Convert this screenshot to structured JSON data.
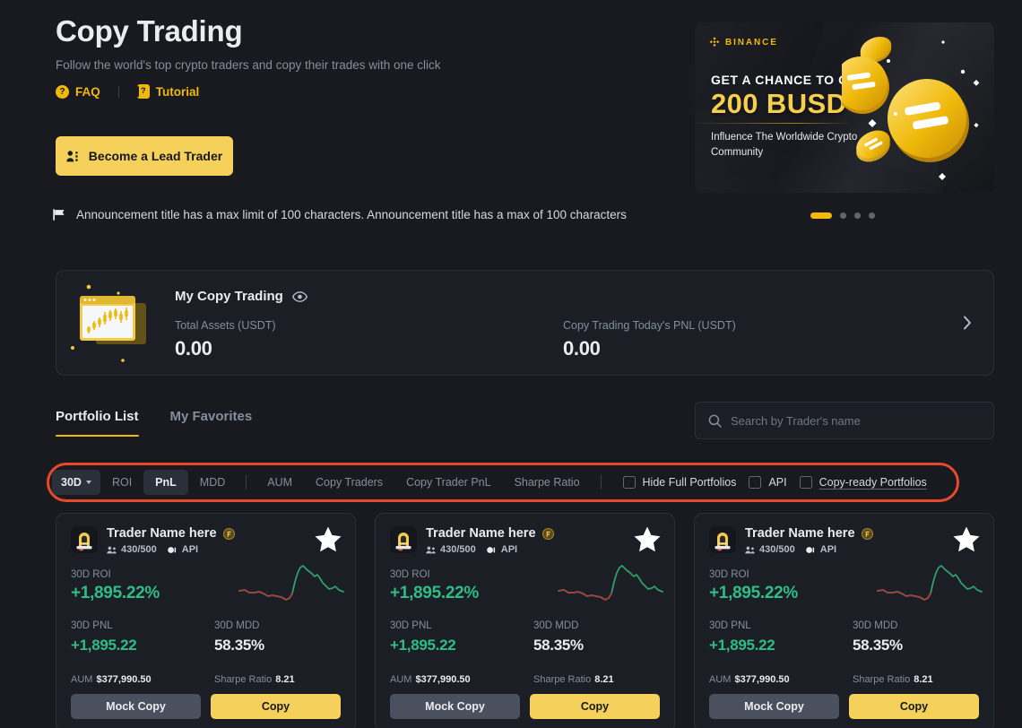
{
  "hero": {
    "title": "Copy Trading",
    "subtitle": "Follow the world's top crypto traders and copy their trades with one click",
    "faq_label": "FAQ",
    "faq_icon": "question-circle-icon",
    "tutorial_label": "Tutorial",
    "tutorial_icon": "book-question-icon",
    "lead_trader_button": "Become a Lead Trader",
    "lead_trader_icon": "people-icon"
  },
  "announcement": {
    "icon": "flag-icon",
    "text": "Announcement title has a max limit of 100 characters. Announcement title has a max of 100 characters"
  },
  "banner": {
    "brand": "BINANCE",
    "brand_icon": "binance-diamond-icon",
    "line1": "GET A CHANCE TO GET",
    "line2": "200 BUSD",
    "line3": "Influence The Worldwide Crypto Community",
    "accent_color": "#f0b90b",
    "carousel": {
      "total": 4,
      "active_index": 0
    }
  },
  "my_copy_trading": {
    "title": "My Copy Trading",
    "eye_icon": "eye-icon",
    "chevron_icon": "chevron-right-icon",
    "illustration_icon": "chart-window-icon",
    "total_assets_label": "Total Assets (USDT)",
    "total_assets_value": "0.00",
    "pnl_label": "Copy Trading  Today's PNL (USDT)",
    "pnl_value": "0.00"
  },
  "tabs": [
    {
      "label": "Portfolio List",
      "active": true
    },
    {
      "label": "My Favorites",
      "active": false
    }
  ],
  "search": {
    "icon": "search-icon",
    "placeholder": "Search by Trader's name",
    "value": ""
  },
  "filters": {
    "period": {
      "label": "30D",
      "caret_icon": "chevron-down-icon"
    },
    "metrics": [
      {
        "label": "ROI",
        "active": false
      },
      {
        "label": "PnL",
        "active": true
      },
      {
        "label": "MDD",
        "active": false
      }
    ],
    "metrics2": [
      {
        "label": "AUM",
        "active": false
      },
      {
        "label": "Copy Traders",
        "active": false
      },
      {
        "label": "Copy Trader PnL",
        "active": false
      },
      {
        "label": "Sharpe Ratio",
        "active": false
      }
    ],
    "checkboxes": [
      {
        "label": "Hide Full Portfolios",
        "checked": false,
        "underlined": false
      },
      {
        "label": "API",
        "checked": false,
        "underlined": false
      },
      {
        "label": "Copy-ready Portfolios",
        "checked": false,
        "underlined": true
      }
    ],
    "highlight_color": "#e8492a"
  },
  "trader_cards": [
    {
      "name": "Trader Name here",
      "badge_icon": "medal-icon",
      "avatar_icon": "trader-avatar-icon",
      "star_icon": "star-filled-icon",
      "copiers_icon": "users-icon",
      "copiers": "430/500",
      "api_icon": "api-icon",
      "api_label": "API",
      "roi_label": "30D ROI",
      "roi_value": "+1,895.22%",
      "pnl_label": "30D PNL",
      "pnl_value": "+1,895.22",
      "mdd_label": "30D MDD",
      "mdd_value": "58.35%",
      "aum_label": "AUM",
      "aum_value": "$377,990.50",
      "sharpe_label": "Sharpe Ratio",
      "sharpe_value": "8.21",
      "mock_copy_label": "Mock Copy",
      "copy_label": "Copy"
    },
    {
      "name": "Trader Name here",
      "badge_icon": "medal-icon",
      "avatar_icon": "trader-avatar-icon",
      "star_icon": "star-filled-icon",
      "copiers_icon": "users-icon",
      "copiers": "430/500",
      "api_icon": "api-icon",
      "api_label": "API",
      "roi_label": "30D ROI",
      "roi_value": "+1,895.22%",
      "pnl_label": "30D PNL",
      "pnl_value": "+1,895.22",
      "mdd_label": "30D MDD",
      "mdd_value": "58.35%",
      "aum_label": "AUM",
      "aum_value": "$377,990.50",
      "sharpe_label": "Sharpe Ratio",
      "sharpe_value": "8.21",
      "mock_copy_label": "Mock Copy",
      "copy_label": "Copy"
    },
    {
      "name": "Trader Name here",
      "badge_icon": "medal-icon",
      "avatar_icon": "trader-avatar-icon",
      "star_icon": "star-filled-icon",
      "copiers_icon": "users-icon",
      "copiers": "430/500",
      "api_icon": "api-icon",
      "api_label": "API",
      "roi_label": "30D ROI",
      "roi_value": "+1,895.22%",
      "pnl_label": "30D PNL",
      "pnl_value": "+1,895.22",
      "mdd_label": "30D MDD",
      "mdd_value": "58.35%",
      "aum_label": "AUM",
      "aum_value": "$377,990.50",
      "sharpe_label": "Sharpe Ratio",
      "sharpe_value": "8.21",
      "mock_copy_label": "Mock Copy",
      "copy_label": "Copy"
    }
  ],
  "colors": {
    "background": "#181a20",
    "card": "#1c1e25",
    "accent": "#f0b90b",
    "positive": "#2ebd85",
    "negative": "#b0413b",
    "muted": "#848e9c"
  }
}
